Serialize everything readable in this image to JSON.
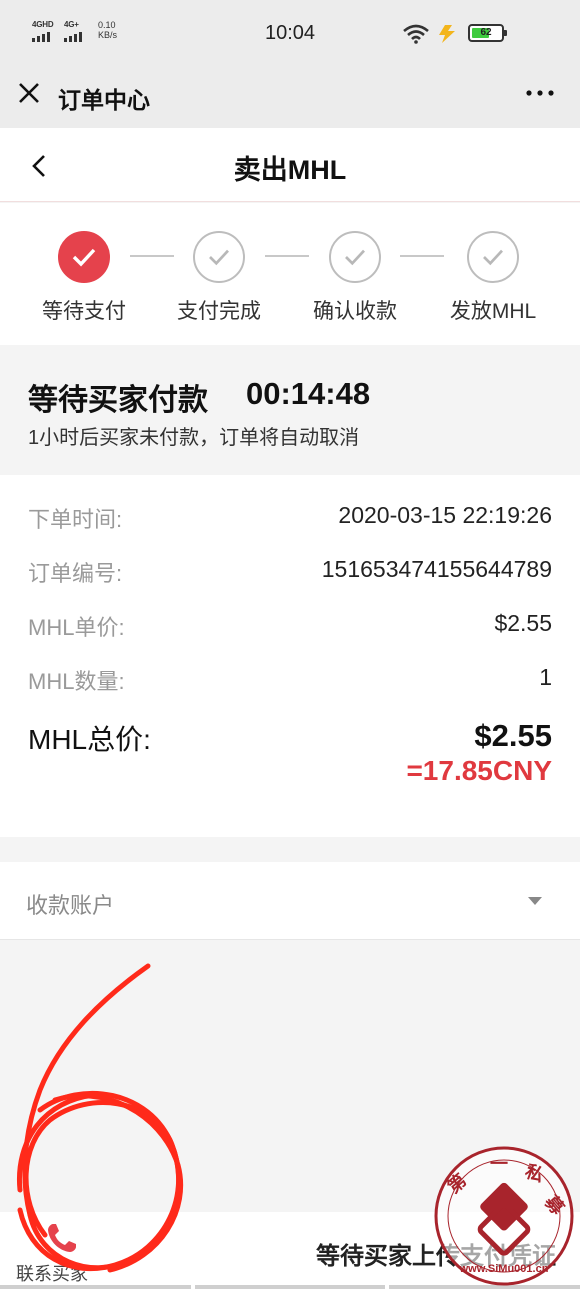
{
  "status_bar": {
    "signal1_label": "4GHD",
    "signal2_label": "4G+",
    "speed_value": "0.10",
    "speed_unit": "KB/s",
    "time": "10:04",
    "battery_percent": "62",
    "battery_level": 0.62
  },
  "top_nav": {
    "title": "订单中心"
  },
  "page": {
    "title": "卖出MHL"
  },
  "steps": [
    {
      "label": "等待支付",
      "active": true
    },
    {
      "label": "支付完成",
      "active": false
    },
    {
      "label": "确认收款",
      "active": false
    },
    {
      "label": "发放MHL",
      "active": false
    }
  ],
  "status": {
    "title": "等待买家付款",
    "countdown": "00:14:48",
    "notice": "1小时后买家未付款，订单将自动取消"
  },
  "details": {
    "order_time_label": "下单时间:",
    "order_time_value": "2020-03-15 22:19:26",
    "order_no_label": "订单编号:",
    "order_no_value": "1516534741556447​89",
    "unit_price_label": "MHL单价:",
    "unit_price_value": "$2.55",
    "quantity_label": "MHL数量:",
    "quantity_value": "1",
    "total_label": "MHL总价:",
    "total_value": "$2.55",
    "total_cny": "=17.85CNY"
  },
  "account": {
    "label": "收款账户"
  },
  "bottom": {
    "contact_label": "联系买家",
    "waiting_text": "等待买家上传支付凭证"
  },
  "colors": {
    "accent": "#e5424c",
    "cny_red": "#e0393f",
    "scribble_red": "#ff2a1a",
    "watermark_red": "#a8242c"
  },
  "watermark": {
    "text": "第一私募 www.SiMu001.cn"
  }
}
